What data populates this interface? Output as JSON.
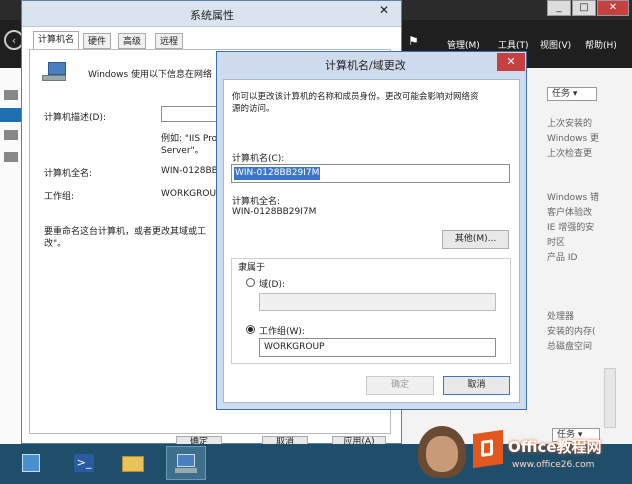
{
  "server_manager": {
    "menu": [
      "管理(M)",
      "工具(T)",
      "视图(V)",
      "帮助(H)"
    ],
    "tasks_label": "任务",
    "right_list": [
      "上次安装的",
      "Windows 更",
      "上次检查更",
      "Windows 错",
      "客户体验改",
      "IE 增强的安",
      "时区",
      "产品 ID",
      "处理器",
      "安装的内存(",
      "总磁盘空间"
    ]
  },
  "system_props": {
    "title": "系统属性",
    "tabs": [
      "计算机名",
      "硬件",
      "高级",
      "远程"
    ],
    "intro": "Windows 使用以下信息在网络",
    "desc_label": "计算机描述(D):",
    "desc_example": "例如: \"IIS Pro",
    "desc_example2": "Server\"。",
    "fullname_label": "计算机全名:",
    "fullname_value": "WIN-0128BB",
    "workgroup_label": "工作组:",
    "workgroup_value": "WORKGROU",
    "rename_text": "要重命名这台计算机，或者更改其域或工",
    "rename_text2": "改\"。",
    "ok_label": "确定",
    "cancel_label": "取消",
    "apply_label": "应用(A)"
  },
  "dialog": {
    "title": "计算机名/域更改",
    "info_line1": "你可以更改该计算机的名称和成员身份。更改可能会影响对网络资",
    "info_line2": "源的访问。",
    "computer_name_label": "计算机名(C):",
    "computer_name_value": "WIN-0128BB29I7M",
    "full_name_label": "计算机全名:",
    "full_name_value": "WIN-0128BB29I7M",
    "more_label": "其他(M)...",
    "member_of_label": "隶属于",
    "domain_label": "域(D):",
    "domain_value": "",
    "workgroup_label": "工作组(W):",
    "workgroup_value": "WORKGROUP",
    "ok_label": "确定",
    "cancel_label": "取消"
  },
  "watermark": {
    "brand": "Office教程网",
    "url": "www.office26.com"
  }
}
